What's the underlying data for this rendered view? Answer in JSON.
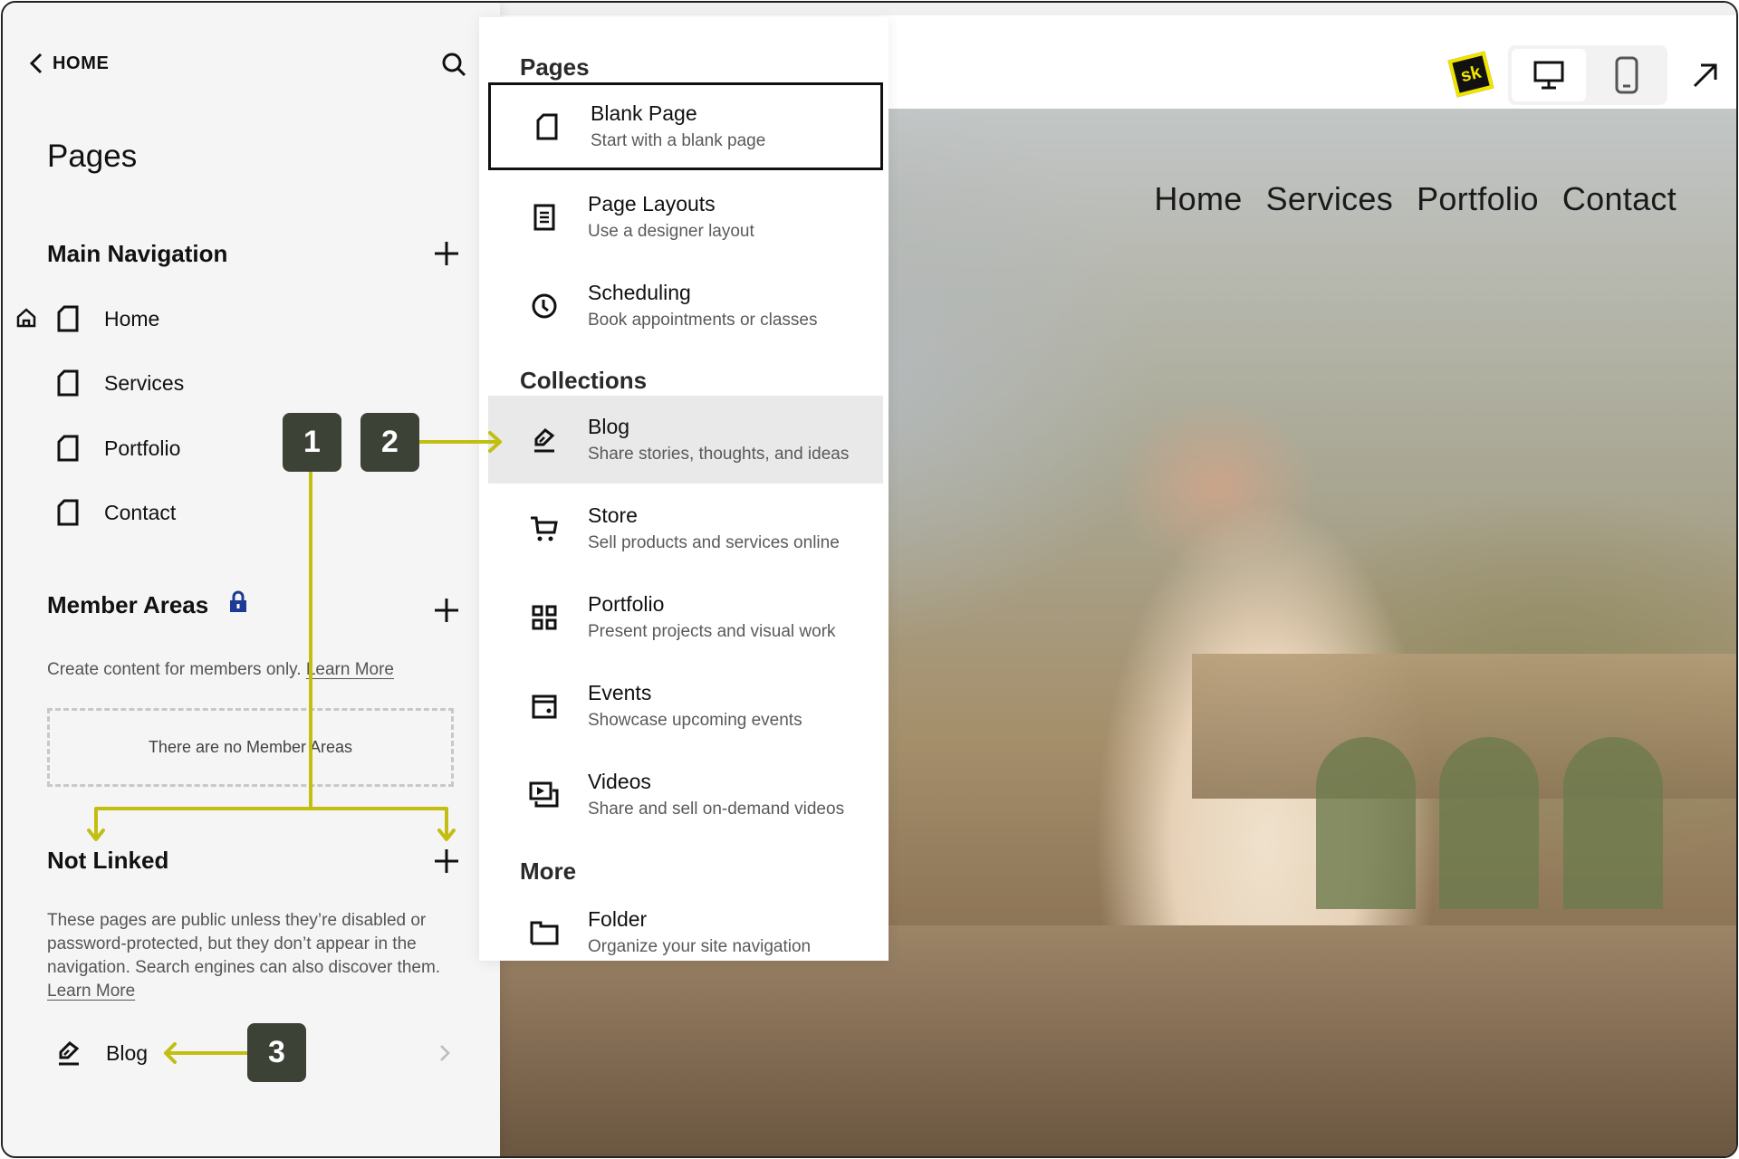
{
  "sidebar": {
    "back_label": "HOME",
    "title": "Pages",
    "main_navigation": {
      "title": "Main Navigation",
      "items": [
        {
          "label": "Home",
          "is_homepage": true
        },
        {
          "label": "Services"
        },
        {
          "label": "Portfolio"
        },
        {
          "label": "Contact"
        }
      ]
    },
    "member_areas": {
      "title": "Member Areas",
      "description": "Create content for members only.",
      "learn_more": "Learn More",
      "empty_state": "There are no Member Areas"
    },
    "not_linked": {
      "title": "Not Linked",
      "description": "These pages are public unless they’re disabled or password-protected, but they don’t appear in the navigation. Search engines can also discover them.",
      "learn_more": "Learn More",
      "items": [
        {
          "label": "Blog"
        }
      ]
    }
  },
  "add_page_menu": {
    "sections": [
      {
        "heading": "Pages",
        "items": [
          {
            "title": "Blank Page",
            "subtitle": "Start with a blank page",
            "icon": "page-icon"
          },
          {
            "title": "Page Layouts",
            "subtitle": "Use a designer layout",
            "icon": "layout-icon"
          },
          {
            "title": "Scheduling",
            "subtitle": "Book appointments or classes",
            "icon": "clock-icon"
          }
        ]
      },
      {
        "heading": "Collections",
        "items": [
          {
            "title": "Blog",
            "subtitle": "Share stories, thoughts, and ideas",
            "icon": "pen-icon"
          },
          {
            "title": "Store",
            "subtitle": "Sell products and services online",
            "icon": "cart-icon"
          },
          {
            "title": "Portfolio",
            "subtitle": "Present projects and visual work",
            "icon": "grid-icon"
          },
          {
            "title": "Events",
            "subtitle": "Showcase upcoming events",
            "icon": "calendar-icon"
          },
          {
            "title": "Videos",
            "subtitle": "Share and sell on-demand videos",
            "icon": "video-icon"
          }
        ]
      },
      {
        "heading": "More",
        "items": [
          {
            "title": "Folder",
            "subtitle": "Organize your site navigation",
            "icon": "folder-icon"
          }
        ]
      }
    ]
  },
  "preview": {
    "logo_text": "sk",
    "site_nav": [
      "Home",
      "Services",
      "Portfolio",
      "Contact"
    ],
    "device_modes": [
      "desktop",
      "mobile"
    ],
    "active_device": "desktop"
  },
  "annotations": {
    "badges": [
      "1",
      "2",
      "3"
    ],
    "accent_color": "#c2bf12",
    "badge_color": "#3c4236"
  }
}
